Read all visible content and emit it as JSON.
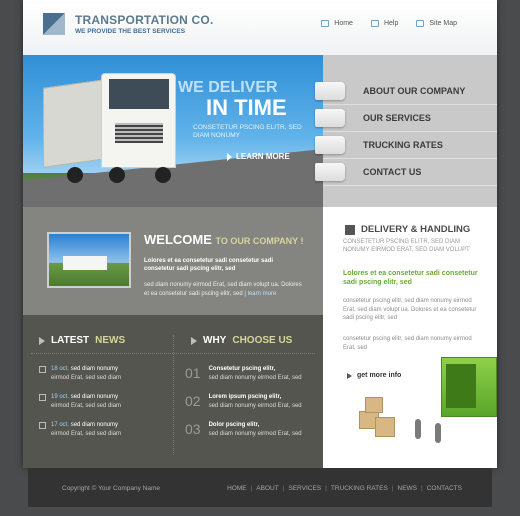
{
  "header": {
    "logo_title": "TRANSPORTATION CO.",
    "logo_subtitle": "WE PROVIDE THE BEST SERVICES",
    "nav": [
      {
        "label": "Home",
        "icon": "home-icon"
      },
      {
        "label": "Help",
        "icon": "help-icon"
      },
      {
        "label": "Site Map",
        "icon": "sitemap-icon"
      }
    ]
  },
  "banner": {
    "slogan_line1": "WE DELIVER",
    "slogan_line2": "IN TIME",
    "slogan_text": "CONSETETUR PSCING ELITR, SED DIAM NONUMY",
    "learn_more": "LEARN MORE"
  },
  "side_menu": {
    "items": [
      "ABOUT OUR COMPANY",
      "OUR SERVICES",
      "TRUCKING RATES",
      "CONTACT US"
    ]
  },
  "welcome": {
    "title": "WELCOME",
    "title_sub": "TO OUR COMPANY !",
    "bold_text": "Lolores et ea consetetur sadi consetetur sadi consetetur sadi pscing elitr, sed",
    "body_text": "sed diam nonumy eirmod Erat, sed diam volupt ua. Dolores et ea consetetur sadi pscing elitr, sed |",
    "link": "learn more"
  },
  "latest_news": {
    "title": "LATEST",
    "title_em": "NEWS",
    "items": [
      {
        "date": "18 oct.",
        "link": "sed diam nonumy",
        "text": "eirmod Erat, sed sed diam"
      },
      {
        "date": "19 oct.",
        "link": "sed diam nonumy",
        "text": "eirmod Erat, sed sed diam"
      },
      {
        "date": "17 oct.",
        "link": "sed diam nonumy",
        "text": "eirmod Erat, sed sed diam"
      }
    ]
  },
  "why_us": {
    "title": "WHY",
    "title_em": "CHOOSE US",
    "items": [
      {
        "num": "01",
        "bold": "Consetetur pscing elitr,",
        "text": "sed diam nonumy eirmod Erat, sed"
      },
      {
        "num": "02",
        "bold": "Lorem ipsum pscing elitr,",
        "text": "sed diam nonumy eirmod Erat, sed"
      },
      {
        "num": "03",
        "bold": "Dolor pscing elitr,",
        "text": "sed diam nonumy eirmod Erat, sed"
      }
    ]
  },
  "delivery": {
    "title": "DELIVERY & HANDLING",
    "subtitle": "CONSETETUR PSCING ELITR, SED DIAM NONUMY EIRMOD ERAT, SED DIAM VOLUPT",
    "green_text": "Lolores et ea consetetur sadi consetetur sadi pscing elitr, sed",
    "text1": "consetetur pscing elitr, sed diam nonumy eirmod Erat, sed diam volupt ua. Dolores et ea consetetur sadi pscing elitr, sed",
    "text2": "consetetur pscing elitr, sed diam nonumy eirmod Erat, sed",
    "get_more": "get more info"
  },
  "footer": {
    "copyright": "Copyright © Your Company Name",
    "nav": [
      "HOME",
      "ABOUT",
      "SERVICES",
      "TRUCKING RATES",
      "NEWS",
      "CONTACTS"
    ]
  },
  "colors": {
    "accent_blue": "#3f6d96",
    "accent_green": "#6aa83a",
    "panel_gray": "#848480",
    "footer": "#333333"
  }
}
